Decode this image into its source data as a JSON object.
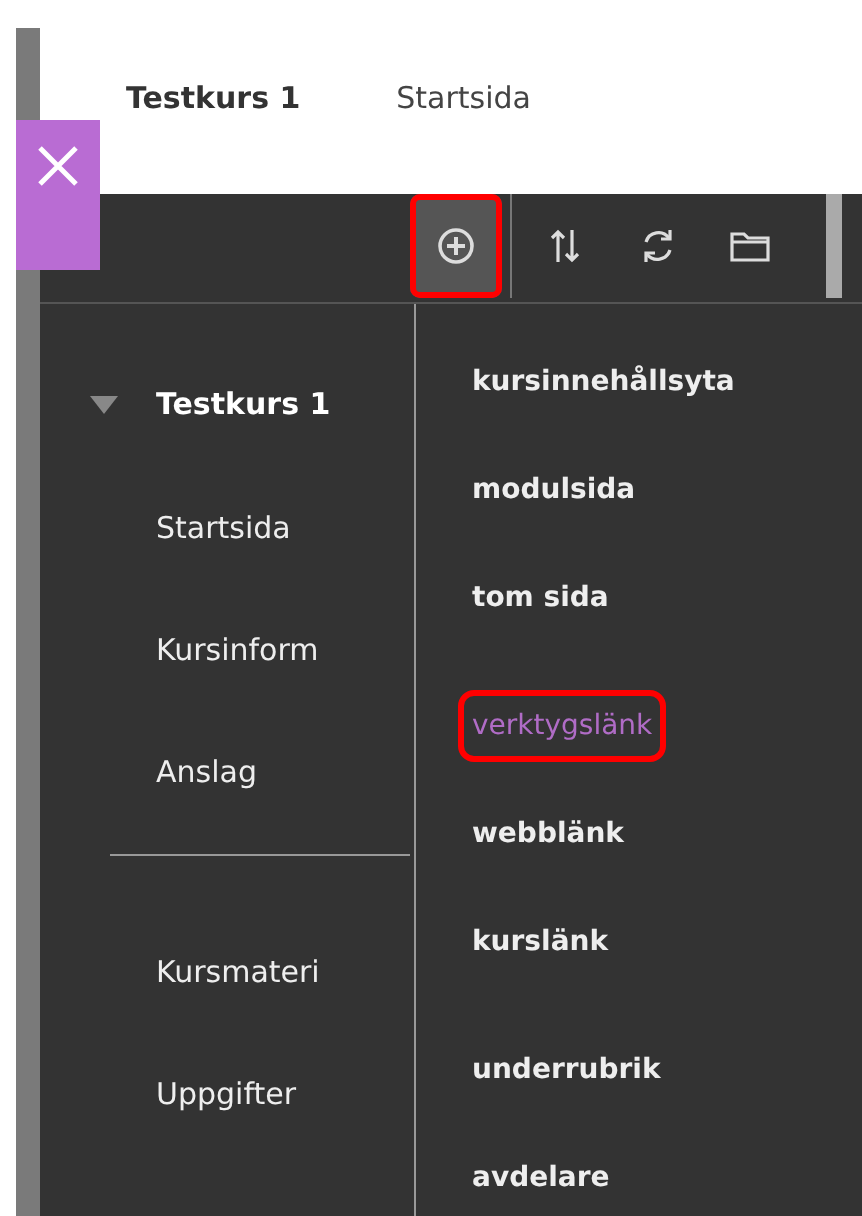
{
  "header": {
    "course_title": "Testkurs 1",
    "breadcrumb": "Startsida"
  },
  "toolbar": [
    {
      "kind": "add",
      "highlighted": true,
      "selected": true
    },
    {
      "kind": "sort",
      "highlighted": false,
      "selected": false
    },
    {
      "kind": "refresh",
      "highlighted": false,
      "selected": false
    },
    {
      "kind": "folder",
      "highlighted": false,
      "selected": false
    }
  ],
  "sidebar": {
    "course": {
      "label": "Testkurs 1",
      "expanded": true
    },
    "items": [
      {
        "label": "Startsida",
        "kind": "link"
      },
      {
        "label": "Kursinform",
        "kind": "link"
      },
      {
        "label": "Anslag",
        "kind": "link"
      },
      {
        "kind": "divider"
      },
      {
        "label": "Kursmateri",
        "kind": "link"
      },
      {
        "label": "Uppgifter",
        "kind": "link"
      }
    ]
  },
  "add_menu": [
    [
      {
        "label": "kursinnehållsyta",
        "highlighted": false
      },
      {
        "label": "modulsida",
        "highlighted": false
      },
      {
        "label": "tom sida",
        "highlighted": false
      }
    ],
    [
      {
        "label": "verktygslänk",
        "highlighted": true
      },
      {
        "label": "webblänk",
        "highlighted": false
      },
      {
        "label": "kurslänk",
        "highlighted": false
      }
    ],
    [
      {
        "label": "underrubrik",
        "highlighted": false
      },
      {
        "label": "avdelare",
        "highlighted": false
      }
    ]
  ]
}
